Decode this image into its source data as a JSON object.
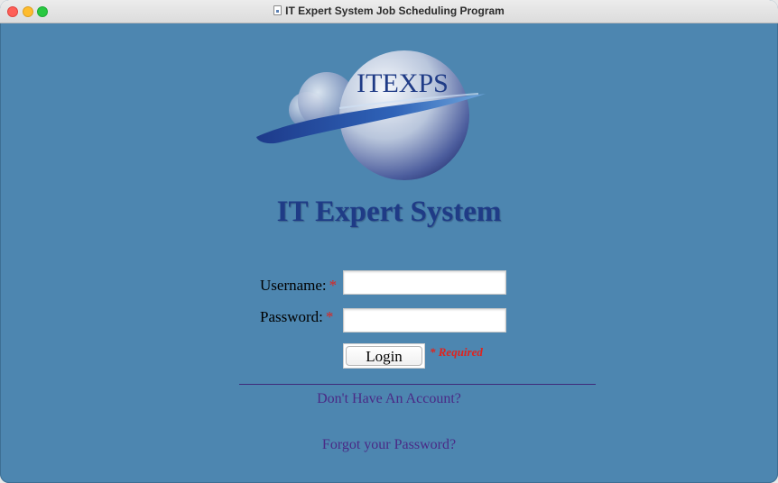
{
  "window": {
    "title": "IT Expert System Job Scheduling Program"
  },
  "logo": {
    "text": "ITEXPS"
  },
  "header": {
    "app_title": "IT Expert System"
  },
  "form": {
    "username_label": "Username:",
    "password_label": "Password:",
    "required_star": "*",
    "username_value": "",
    "password_value": "",
    "login_label": "Login",
    "required_note": "* Required"
  },
  "links": {
    "no_account": "Don't Have An Account?",
    "forgot_password": "Forgot your Password?"
  },
  "colors": {
    "background": "#4d86b0",
    "title_text": "#1f3b86",
    "required": "#e0231d",
    "link": "#4a2a86"
  }
}
